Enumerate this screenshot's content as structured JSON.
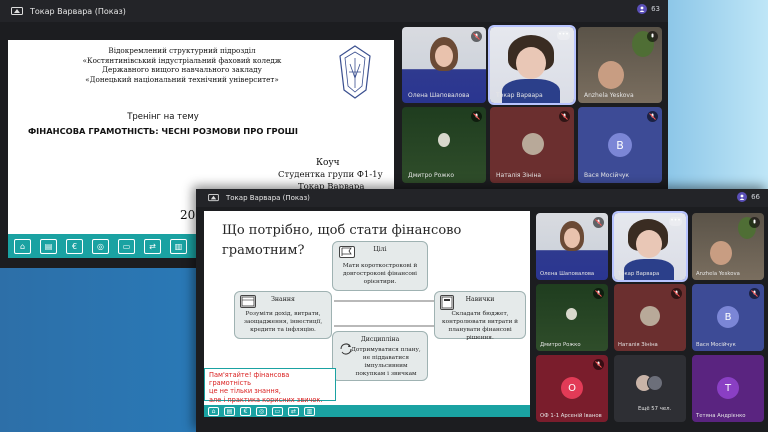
{
  "window1": {
    "title": "Токар Варвара (Показ)",
    "participant_count": "63",
    "slide": {
      "org_lines": [
        "Відокремлений структурний підрозділ",
        "«Костянтинівський індустріальний фаховий коледж",
        "Державного вищого навчального закладу",
        "«Донецький національний технічний університет»"
      ],
      "training_line": "Тренінг на тему",
      "topic": "ФІНАНСОВА ГРАМОТНІСТЬ: ЧЕСНІ РОЗМОВИ ПРО ГРОШІ",
      "coach_label": "Коуч",
      "group_line": "Студентка групи Ф1-1у",
      "name_line": "Токар Варвара",
      "year_fragment": "20"
    },
    "participants": [
      {
        "name": "Олена Шаповалова",
        "muted": true,
        "type": "video"
      },
      {
        "name": "Токар Варвара",
        "muted": false,
        "type": "video",
        "selected": true
      },
      {
        "name": "Anzhela Yeskova",
        "muted": false,
        "type": "video"
      },
      {
        "name": "Дмитро Рожко",
        "muted": true,
        "type": "video"
      },
      {
        "name": "Наталія Зініна",
        "muted": true,
        "type": "video"
      },
      {
        "name": "Вася Мосійчук",
        "muted": true,
        "type": "avatar",
        "initial": "В",
        "color": "#7b86d6"
      }
    ]
  },
  "window2": {
    "title": "Токар Варвара (Показ)",
    "participant_count": "66",
    "slide": {
      "title_line1": "Що потрібно, щоб стати фінансово",
      "title_line2": "грамотним?",
      "boxes": {
        "goals": {
          "heading": "Цілі",
          "text": "Мати короткострокові й довгострокові фінансові орієнтири."
        },
        "knowledge": {
          "heading": "Знання",
          "text": "Розуміти дохід, витрати, заощадження, інвестиції, кредити та інфляцію."
        },
        "skills": {
          "heading": "Навички",
          "text": "Складати бюджет, контролювати витрати й планувати фінансові рішення."
        },
        "discipline": {
          "heading": "Дисципліна",
          "text": "Дотримуватися плану, не піддаватися імпульсивним покупкам і звичкам"
        }
      },
      "note_lines": [
        "Пам'ятайте! фінансова грамотність",
        "це не тільки знання,",
        "але і практика корисних звичок."
      ]
    },
    "participants": [
      {
        "name": "Олена Шаповалова",
        "muted": true,
        "type": "video"
      },
      {
        "name": "Токар Варвара",
        "muted": false,
        "type": "video",
        "selected": true
      },
      {
        "name": "Anzhela Yeskova",
        "muted": false,
        "type": "video"
      },
      {
        "name": "Дмитро Рожко",
        "muted": true,
        "type": "video"
      },
      {
        "name": "Наталія Зініна",
        "muted": true,
        "type": "video"
      },
      {
        "name": "Вася Мосійчук",
        "muted": true,
        "type": "avatar",
        "initial": "В",
        "color": "#7b86d6"
      },
      {
        "name": "ОФ 1-1 Арсеній Іванов",
        "muted": true,
        "type": "avatar",
        "initial": "О",
        "color": "#e23b57"
      },
      {
        "name": "Ещё 57 чел.",
        "muted": false,
        "type": "more"
      },
      {
        "name": "Тетяна Андрієнко",
        "muted": false,
        "type": "avatar",
        "initial": "Т",
        "color": "#8a3fc4"
      }
    ]
  },
  "colors": {
    "accent_teal": "#1aa2a2",
    "note_red": "#d91f1f",
    "selected_outline": "#b8c4ff"
  }
}
